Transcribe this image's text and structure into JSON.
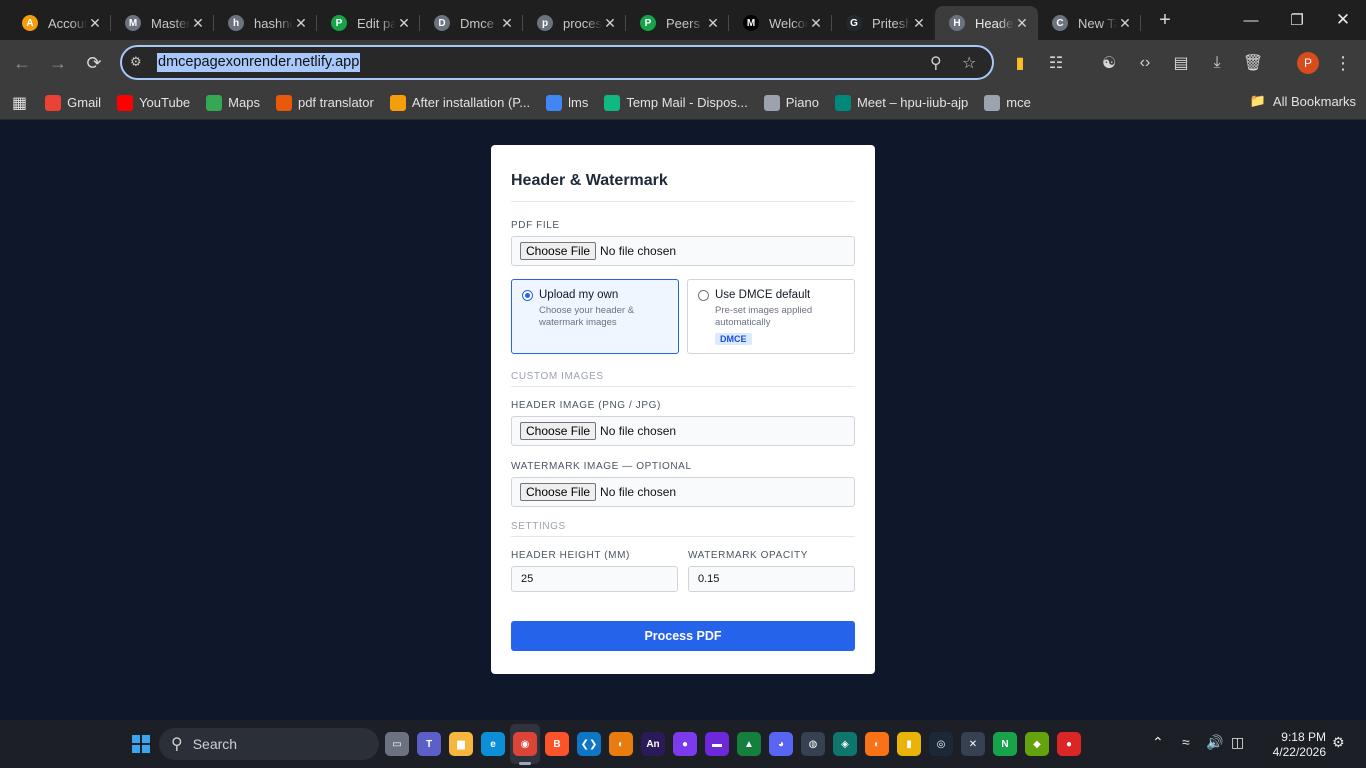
{
  "browser": {
    "tabs": [
      {
        "title": "Account",
        "favicon": "A",
        "color": "#f59e0b"
      },
      {
        "title": "Master",
        "favicon": "M",
        "color": "#6b7280"
      },
      {
        "title": "hashnode",
        "favicon": "h",
        "color": "#6b7280"
      },
      {
        "title": "Edit page",
        "favicon": "P",
        "color": "#16a34a"
      },
      {
        "title": "Dmce",
        "favicon": "D",
        "color": "#6b7280"
      },
      {
        "title": "process",
        "favicon": "p",
        "color": "#6b7280"
      },
      {
        "title": "Peers",
        "favicon": "P",
        "color": "#16a34a"
      },
      {
        "title": "Welcome",
        "favicon": "M",
        "color": "#000000"
      },
      {
        "title": "Pritesh",
        "favicon": "G",
        "color": "#24292e"
      },
      {
        "title": "Header",
        "favicon": "H",
        "color": "#6b7280"
      },
      {
        "title": "New Tab",
        "favicon": "C",
        "color": "#6b7280"
      }
    ],
    "active_tab_index": 9,
    "url": "dmcepagexonrender.netlify.app",
    "bookmarks": [
      {
        "label": "Gmail",
        "color": "#ea4335"
      },
      {
        "label": "YouTube",
        "color": "#ff0000"
      },
      {
        "label": "Maps",
        "color": "#34a853"
      },
      {
        "label": "pdf translator",
        "color": "#e8590c"
      },
      {
        "label": "After installation (P...",
        "color": "#f59e0b"
      },
      {
        "label": "lms",
        "color": "#4285f4"
      },
      {
        "label": "Temp Mail - Dispos...",
        "color": "#10b981"
      },
      {
        "label": "Piano",
        "color": "#9ca3af"
      },
      {
        "label": "Meet – hpu-iiub-ajp",
        "color": "#00897b"
      },
      {
        "label": "mce",
        "color": "#9ca3af"
      }
    ],
    "all_bookmarks": "All Bookmarks",
    "profile_initial": "P"
  },
  "form": {
    "title": "Header & Watermark",
    "pdf_file_label": "PDF FILE",
    "choose_file": "Choose File",
    "no_file": "No file chosen",
    "option_own": {
      "title": "Upload my own",
      "desc": "Choose your header & watermark images"
    },
    "option_default": {
      "title": "Use DMCE default",
      "desc": "Pre-set images applied automatically",
      "badge": "DMCE"
    },
    "custom_images": "CUSTOM IMAGES",
    "header_image_label": "HEADER IMAGE (PNG / JPG)",
    "watermark_label": "WATERMARK IMAGE — OPTIONAL",
    "settings": "SETTINGS",
    "header_height_label": "HEADER HEIGHT (MM)",
    "header_height_value": "25",
    "opacity_label": "WATERMARK OPACITY",
    "opacity_value": "0.15",
    "submit": "Process PDF"
  },
  "taskbar": {
    "search": "Search",
    "time": "9:18 PM",
    "date": "4/22/2026",
    "apps": [
      {
        "name": "task-view",
        "glyph": "▭",
        "color": "#6b7280"
      },
      {
        "name": "teams",
        "glyph": "T",
        "color": "#5b5fc7"
      },
      {
        "name": "file-explorer",
        "glyph": "▆",
        "color": "#f6b73c"
      },
      {
        "name": "edge",
        "glyph": "e",
        "color": "#0c8fd9"
      },
      {
        "name": "chrome",
        "glyph": "◉",
        "color": "#db4437"
      },
      {
        "name": "brave",
        "glyph": "B",
        "color": "#fb542b"
      },
      {
        "name": "vscode",
        "glyph": "❮❯",
        "color": "#0e76c4"
      },
      {
        "name": "blender",
        "glyph": "◐",
        "color": "#e87d0d"
      },
      {
        "name": "animate",
        "glyph": "An",
        "color": "#2a1a59"
      },
      {
        "name": "app-10",
        "glyph": "●",
        "color": "#7c3aed"
      },
      {
        "name": "app-11",
        "glyph": "▬",
        "color": "#6d28d9"
      },
      {
        "name": "app-12",
        "glyph": "▲",
        "color": "#15803d"
      },
      {
        "name": "discord",
        "glyph": "◕",
        "color": "#5865f2"
      },
      {
        "name": "app-14",
        "glyph": "◍",
        "color": "#374151"
      },
      {
        "name": "app-15",
        "glyph": "◈",
        "color": "#0f766e"
      },
      {
        "name": "app-16",
        "glyph": "◐",
        "color": "#f97316"
      },
      {
        "name": "power-bi",
        "glyph": "▮",
        "color": "#eab308"
      },
      {
        "name": "steam",
        "glyph": "◎",
        "color": "#1b2838"
      },
      {
        "name": "app-19",
        "glyph": "✕",
        "color": "#374151"
      },
      {
        "name": "app-20",
        "glyph": "N",
        "color": "#16a34a"
      },
      {
        "name": "app-21",
        "glyph": "◆",
        "color": "#65a30d"
      },
      {
        "name": "app-22",
        "glyph": "●",
        "color": "#dc2626"
      }
    ]
  }
}
